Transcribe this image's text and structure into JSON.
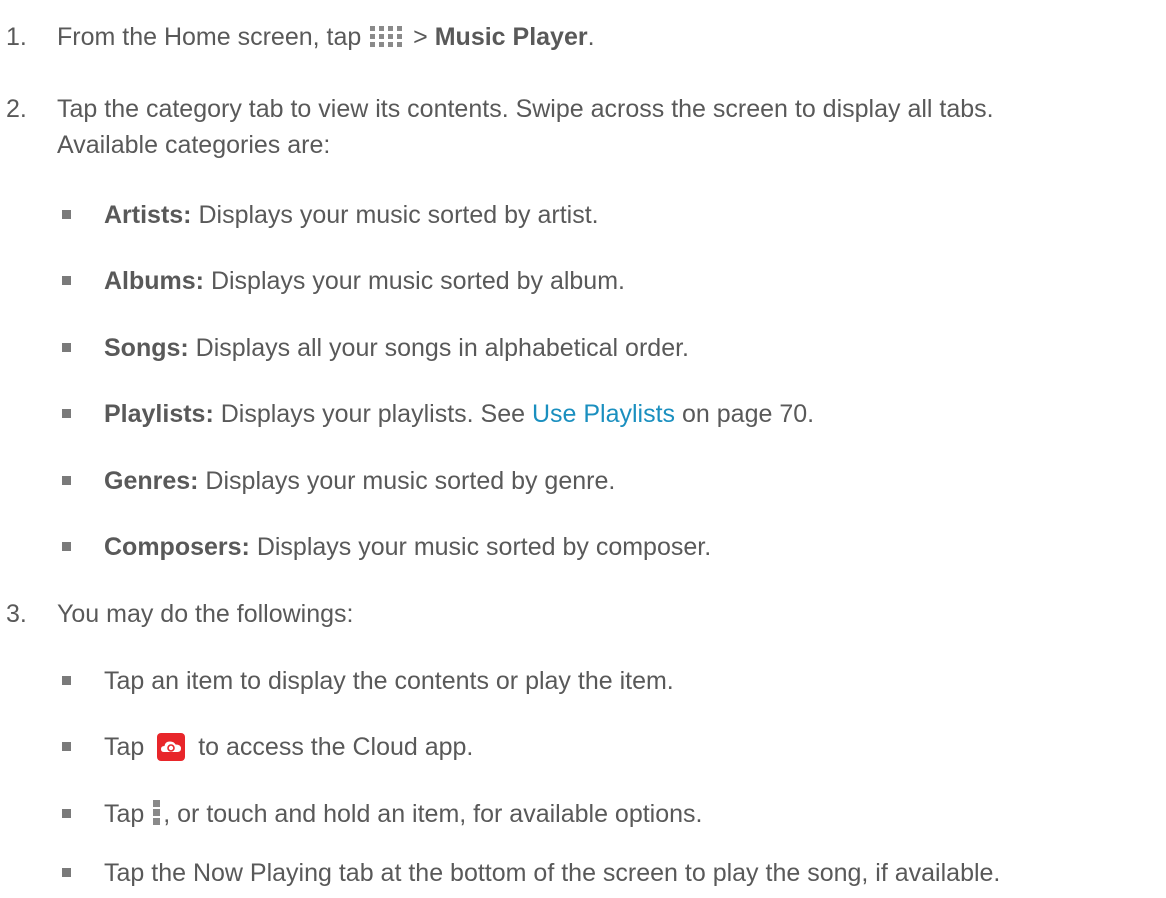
{
  "steps": [
    {
      "number": "1.",
      "pre": "From the Home screen, tap ",
      "icon": "apps-grid-icon",
      "sep": " > ",
      "bold": "Music Player",
      "post": "."
    },
    {
      "number": "2.",
      "line1": "Tap the category tab to view its contents. Swipe across the screen to display all tabs.",
      "line2": "Available categories are:",
      "categories": [
        {
          "term": "Artists:",
          "desc": " Displays your music sorted by artist."
        },
        {
          "term": "Albums:",
          "desc": " Displays your music sorted by album."
        },
        {
          "term": "Songs:",
          "desc": " Displays all your songs in alphabetical order."
        },
        {
          "term": "Playlists:",
          "desc": " Displays your playlists. See ",
          "link": "Use Playlists",
          "after": " on page 70."
        },
        {
          "term": "Genres:",
          "desc": " Displays your music sorted by genre."
        },
        {
          "term": "Composers:",
          "desc": " Displays your music sorted by composer."
        }
      ]
    },
    {
      "number": "3.",
      "text": "You may do the followings:",
      "actions": [
        {
          "text": "Tap an item to display the contents or play the item."
        },
        {
          "pre": "Tap ",
          "icon": "cloud-app-icon",
          "post": " to access the Cloud app."
        },
        {
          "pre": "Tap ",
          "icon": "menu-more-icon",
          "post": ", or touch and hold an item, for available options."
        },
        {
          "text": "Tap the Now Playing tab at the bottom of the screen to play the song, if available."
        }
      ]
    }
  ],
  "colors": {
    "text": "#595959",
    "link": "#1a8fbf",
    "cloud_icon": "#e8262a",
    "bullet": "#7a7a7a"
  }
}
